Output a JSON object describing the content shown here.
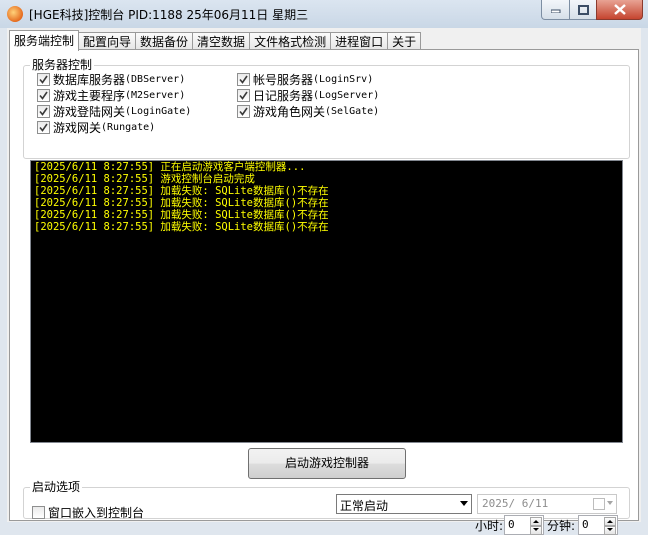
{
  "window": {
    "title": "[HGE科技]控制台 PID:1188 25年06月11日 星期三"
  },
  "tabs": [
    {
      "label": "服务端控制"
    },
    {
      "label": "配置向导"
    },
    {
      "label": "数据备份"
    },
    {
      "label": "清空数据"
    },
    {
      "label": "文件格式检测"
    },
    {
      "label": "进程窗口"
    },
    {
      "label": "关于"
    }
  ],
  "server_group": {
    "title": "服务器控制",
    "items": [
      {
        "label": "数据库服务器",
        "sub": "(DBServer)",
        "checked": true
      },
      {
        "label": "游戏主要程序",
        "sub": "(M2Server)",
        "checked": true
      },
      {
        "label": "游戏登陆网关",
        "sub": "(LoginGate)",
        "checked": true
      },
      {
        "label": "游戏网关",
        "sub": "(Rungate)",
        "checked": true
      },
      {
        "label": "帐号服务器",
        "sub": "(LoginSrv)",
        "checked": true
      },
      {
        "label": "日记服务器",
        "sub": "(LogServer)",
        "checked": true
      },
      {
        "label": "游戏角色网关",
        "sub": "(SelGate)",
        "checked": true
      }
    ]
  },
  "log": {
    "text_color": "#ffff00",
    "lines": [
      "[2025/6/11 8:27:55] 正在启动游戏客户端控制器...",
      "[2025/6/11 8:27:55] 游戏控制台启动完成",
      "[2025/6/11 8:27:55] 加载失败: SQLite数据库()不存在",
      "[2025/6/11 8:27:55] 加载失败: SQLite数据库()不存在",
      "[2025/6/11 8:27:55] 加载失败: SQLite数据库()不存在",
      "[2025/6/11 8:27:55] 加载失败: SQLite数据库()不存在"
    ]
  },
  "start_button": {
    "label": "启动游戏控制器"
  },
  "start_options": {
    "title": "启动选项",
    "embed_checkbox": {
      "label": "窗口嵌入到控制台",
      "checked": false
    },
    "mode_select": {
      "value": "正常启动"
    },
    "date": {
      "value": "2025/ 6/11"
    },
    "hour": {
      "label": "小时:",
      "value": "0"
    },
    "minute": {
      "label": "分钟:",
      "value": "0"
    }
  }
}
